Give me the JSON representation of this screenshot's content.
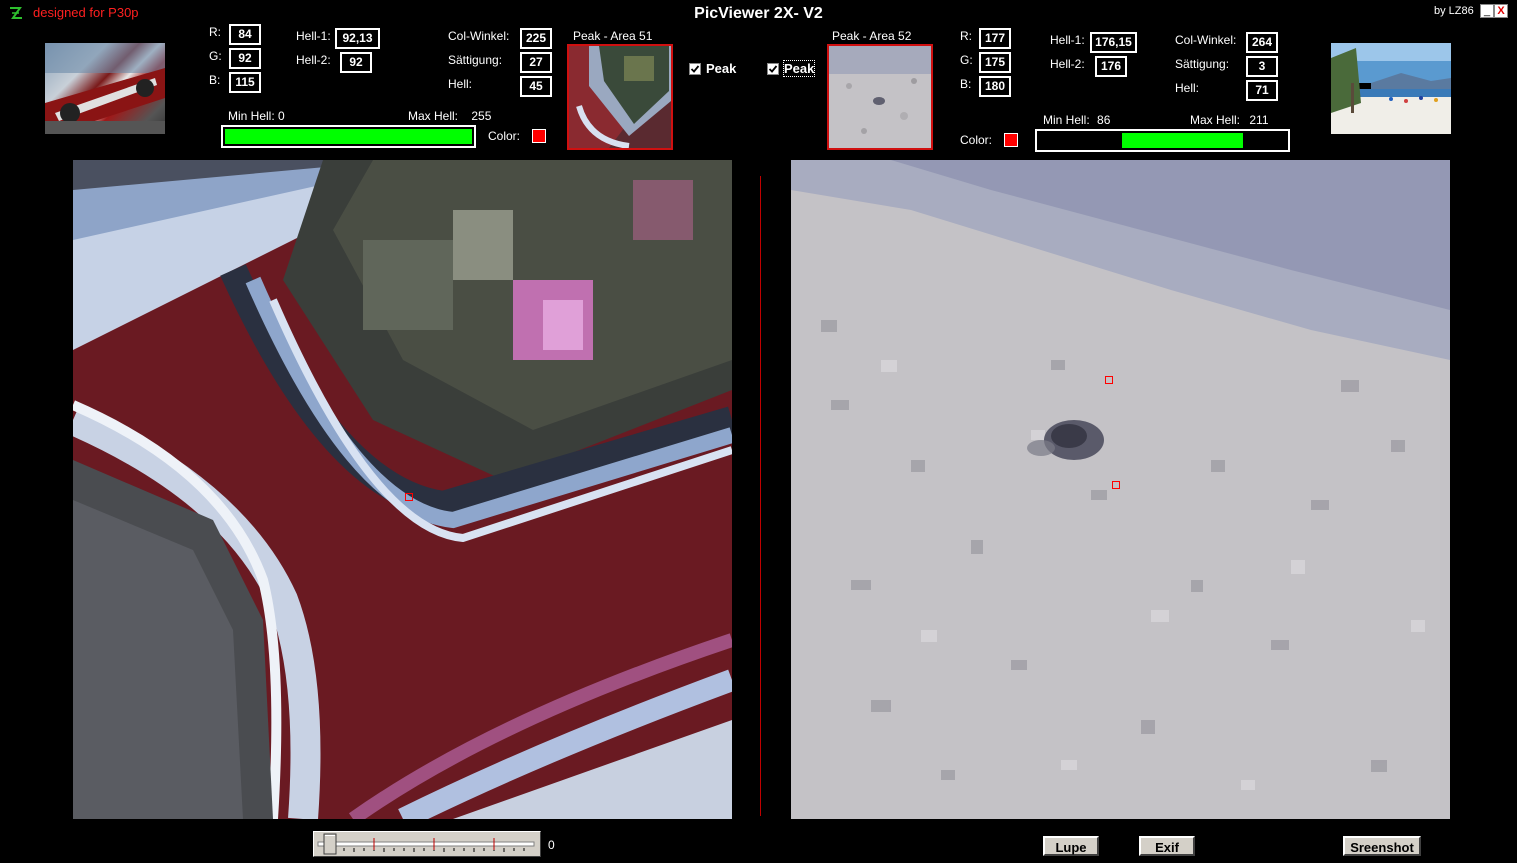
{
  "app": {
    "title": "PicViewer 2X- V2",
    "designed_for": "designed for P30p",
    "byline": "by LZ86",
    "minimize_label": "_",
    "close_label": "X",
    "logo_icon": "app-logo-icon"
  },
  "left": {
    "r_label": "R:",
    "r": "84",
    "g_label": "G:",
    "g": "92",
    "b_label": "B:",
    "b": "115",
    "hell1_label": "Hell-1:",
    "hell1": "92,13",
    "hell2_label": "Hell-2:",
    "hell2": "92",
    "colwinkel_label": "Col-Winkel:",
    "colwinkel": "225",
    "saettigung_label": "Sättigung:",
    "saettigung": "27",
    "hell_label": "Hell:",
    "hell": "45",
    "peak_area_label": "Peak - Area 51",
    "min_hell_label": "Min Hell:",
    "min_hell": "0",
    "max_hell_label": "Max Hell:",
    "max_hell": "255",
    "brightness_range": [
      0,
      255
    ],
    "color_label": "Color:",
    "marker_color": "#ff0000",
    "peak_checkbox_label": "Peak",
    "peak_checked": true
  },
  "right": {
    "r_label": "R:",
    "r": "177",
    "g_label": "G:",
    "g": "175",
    "b_label": "B:",
    "b": "180",
    "hell1_label": "Hell-1:",
    "hell1": "176,15",
    "hell2_label": "Hell-2:",
    "hell2": "176",
    "colwinkel_label": "Col-Winkel:",
    "colwinkel": "264",
    "saettigung_label": "Sättigung:",
    "saettigung": "3",
    "hell_label": "Hell:",
    "hell": "71",
    "peak_area_label": "Peak - Area 52",
    "min_hell_label": "Min Hell:",
    "min_hell": "86",
    "max_hell_label": "Max Hell:",
    "max_hell": "211",
    "brightness_range": [
      86,
      211
    ],
    "color_label": "Color:",
    "marker_color": "#ff0000",
    "peak_checkbox_label": "Peak",
    "peak_checked": true
  },
  "footer": {
    "slider_value": "0",
    "lupe_label": "Lupe",
    "exif_label": "Exif",
    "screenshot_label": "Sreenshot"
  },
  "colors": {
    "accent_red": "#d01010",
    "bar_green": "#00ff00",
    "background": "#000000"
  }
}
